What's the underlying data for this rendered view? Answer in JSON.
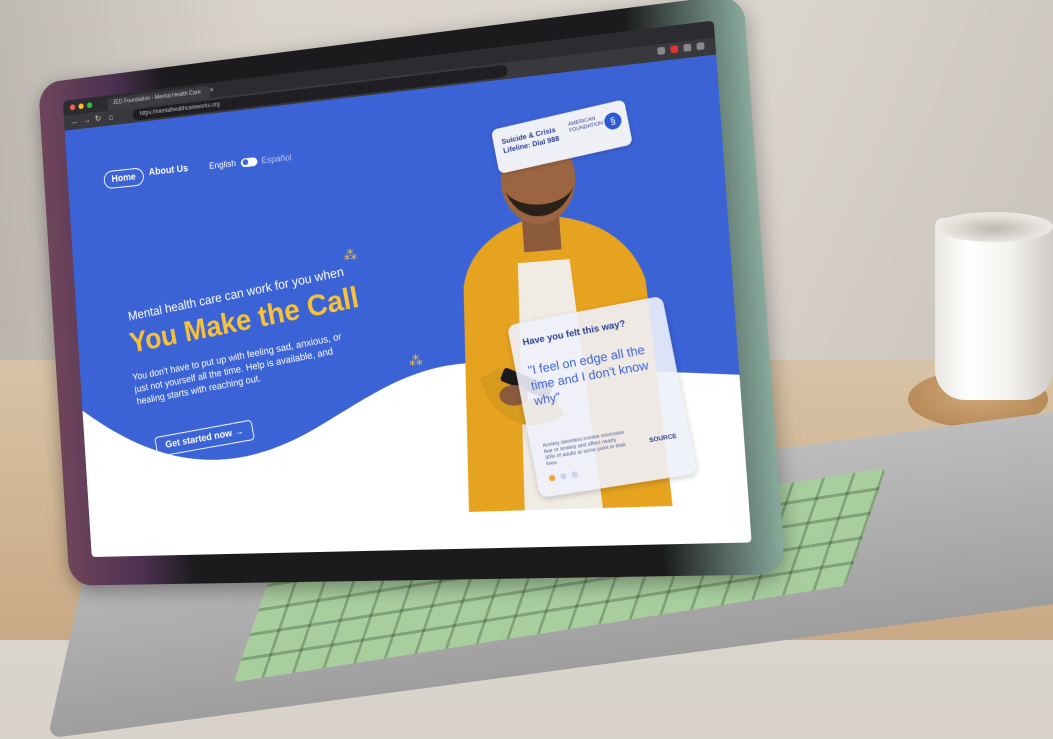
{
  "browser": {
    "tab_title": "JED Foundation - Mental Health Care",
    "url": "https://mentalhealthcareworks.org"
  },
  "nav": {
    "home_label": "Home",
    "about_label": "About Us",
    "lang_english": "English",
    "lang_spanish": "Español"
  },
  "hero": {
    "subtitle": "Mental health care can work for you when",
    "title": "You Make the Call",
    "body": "You don't have to put up with feeling sad, anxious, or just not yourself all the time. Help is available, and healing starts with reaching out.",
    "cta_label": "Get started now"
  },
  "badge": {
    "line1": "Suicide & Crisis",
    "line2": "Lifeline: Dial 988",
    "org": "AMERICAN FOUNDATION"
  },
  "card": {
    "title": "Have you felt this way?",
    "quote": "\"I feel on edge all the time and I don't know why\"",
    "fine_print": "Anxiety disorders involve excessive fear or anxiety and affect nearly 30% of adults at some point in their lives.",
    "source_label": "SOURCE"
  },
  "colors": {
    "brand_blue": "#3b63d6",
    "accent_yellow": "#f5c239"
  }
}
